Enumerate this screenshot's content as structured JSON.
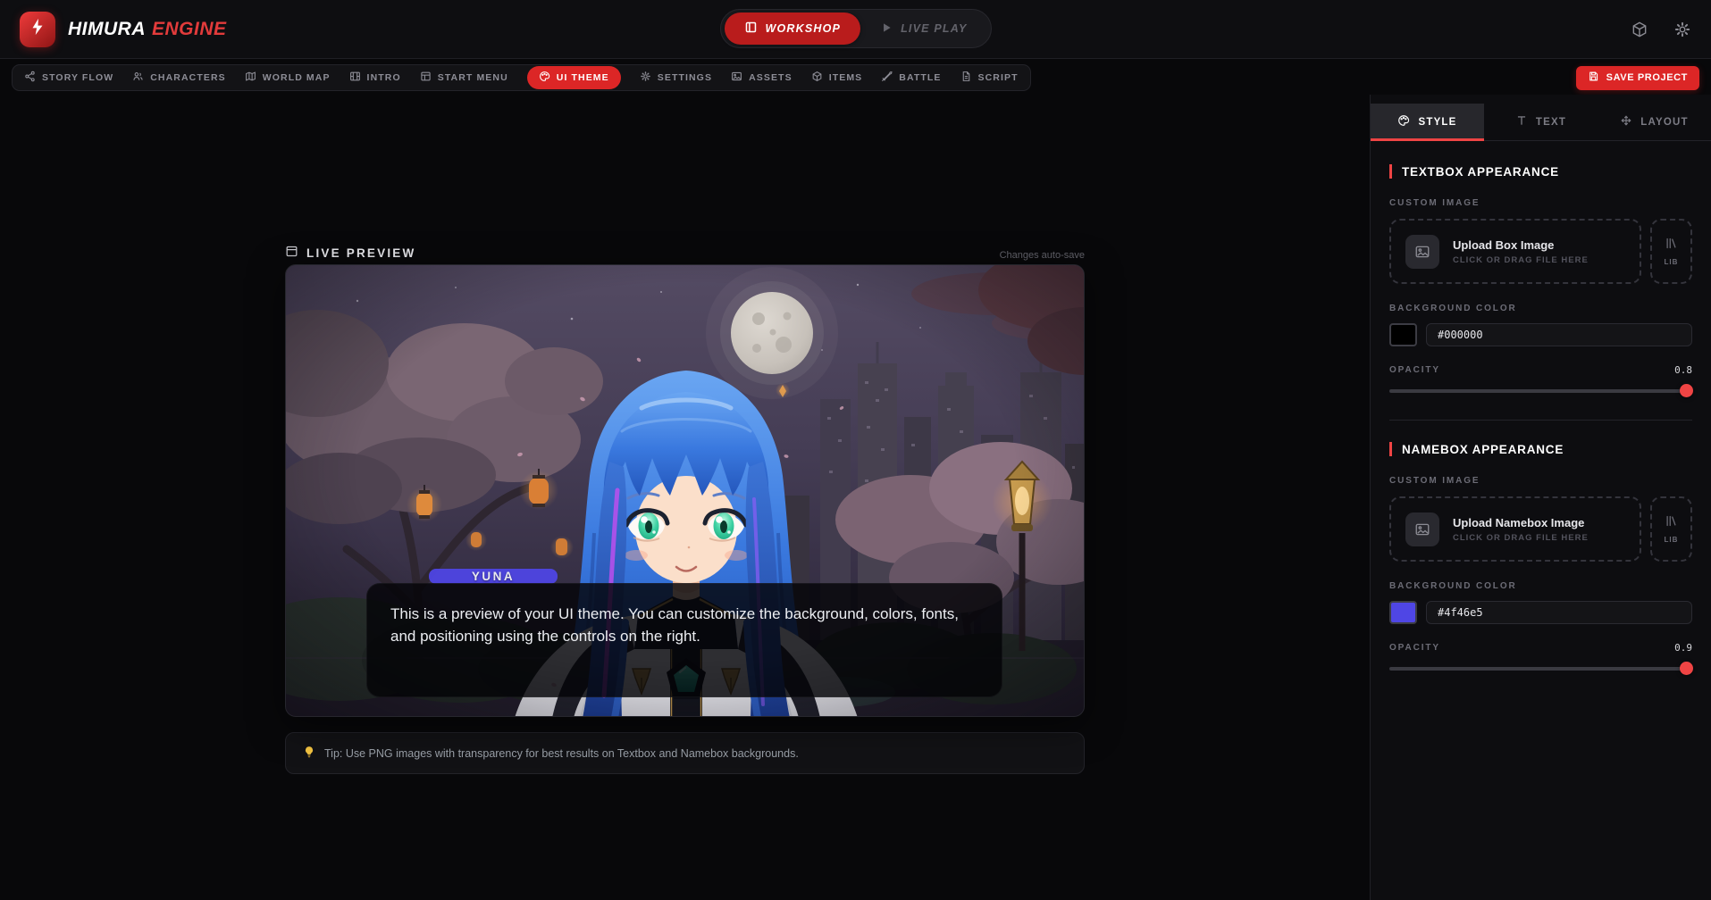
{
  "header": {
    "brand": {
      "primary": "HIMURA",
      "accent": "ENGINE"
    },
    "mode_toggle": {
      "workshop": "WORKSHOP",
      "live_play": "LIVE PLAY"
    }
  },
  "nav": {
    "items": [
      {
        "label": "STORY FLOW",
        "icon": "share-icon"
      },
      {
        "label": "CHARACTERS",
        "icon": "users-icon"
      },
      {
        "label": "WORLD MAP",
        "icon": "map-icon"
      },
      {
        "label": "INTRO",
        "icon": "film-icon"
      },
      {
        "label": "START MENU",
        "icon": "window-icon"
      },
      {
        "label": "UI THEME",
        "icon": "palette-icon",
        "active": true
      },
      {
        "label": "SETTINGS",
        "icon": "gear-icon"
      },
      {
        "label": "ASSETS",
        "icon": "image-icon"
      },
      {
        "label": "ITEMS",
        "icon": "box-icon"
      },
      {
        "label": "BATTLE",
        "icon": "sword-icon"
      },
      {
        "label": "SCRIPT",
        "icon": "file-icon"
      }
    ],
    "save_button": "SAVE PROJECT"
  },
  "preview": {
    "title": "LIVE PREVIEW",
    "autosave_note": "Changes auto-save",
    "namebox_text": "YUNA",
    "dialogue": "This is a preview of your UI theme. You can customize the background, colors, fonts, and positioning using the controls on the right.",
    "tip": "Tip: Use PNG images with transparency for best results on Textbox and Namebox backgrounds."
  },
  "panel": {
    "tabs": [
      {
        "label": "STYLE",
        "active": true
      },
      {
        "label": "TEXT"
      },
      {
        "label": "LAYOUT"
      }
    ],
    "sections": [
      {
        "title": "TEXTBOX APPEARANCE",
        "custom_image_label": "CUSTOM IMAGE",
        "upload_title": "Upload Box Image",
        "upload_subtitle": "CLICK OR DRAG FILE HERE",
        "lib_label": "LIB",
        "bg_color_label": "BACKGROUND COLOR",
        "bg_color_value": "#000000",
        "opacity_label": "OPACITY",
        "opacity_value": "0.8"
      },
      {
        "title": "NAMEBOX APPEARANCE",
        "custom_image_label": "CUSTOM IMAGE",
        "upload_title": "Upload Namebox Image",
        "upload_subtitle": "CLICK OR DRAG FILE HERE",
        "lib_label": "LIB",
        "bg_color_label": "BACKGROUND COLOR",
        "bg_color_value": "#4f46e5",
        "opacity_label": "OPACITY",
        "opacity_value": "0.9"
      }
    ]
  },
  "colors": {
    "accent_red": "#dc2626",
    "tab_underline": "#ef4444",
    "namebox_bg": "#4f46e5",
    "textbox_bg": "#000000",
    "slider_thumb": "#ef4444"
  }
}
